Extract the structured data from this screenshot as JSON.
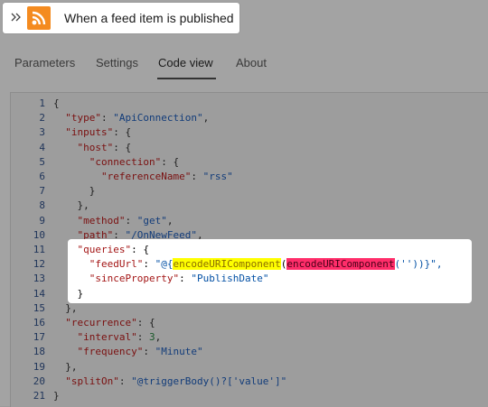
{
  "trigger": {
    "title": "When a feed item is published",
    "icon": "rss-icon",
    "accent": "#f48b20"
  },
  "tabs": [
    {
      "label": "Parameters",
      "active": false
    },
    {
      "label": "Settings",
      "active": false
    },
    {
      "label": "Code view",
      "active": true
    },
    {
      "label": "About",
      "active": false
    }
  ],
  "code": {
    "line_numbers": [
      "1",
      "2",
      "3",
      "4",
      "5",
      "6",
      "7",
      "8",
      "9",
      "10",
      "11",
      "12",
      "13",
      "14",
      "15",
      "16",
      "17",
      "18",
      "19",
      "20",
      "21"
    ],
    "lines": [
      "{",
      "  \"type\": \"ApiConnection\",",
      "  \"inputs\": {",
      "    \"host\": {",
      "      \"connection\": {",
      "        \"referenceName\": \"rss\"",
      "      }",
      "    },",
      "    \"method\": \"get\",",
      "    \"path\": \"/OnNewFeed\",",
      "    \"queries\": {",
      "      \"feedUrl\": \"@{encodeURIComponent(encodeURIComponent(''))}\",",
      "      \"sinceProperty\": \"PublishDate\"",
      "    }",
      "  },",
      "  \"recurrence\": {",
      "    \"interval\": 3,",
      "    \"frequency\": \"Minute\"",
      "  },",
      "  \"splitOn\": \"@triggerBody()?['value']\"",
      "}"
    ]
  },
  "highlights": {
    "outer_function": "encodeURIComponent",
    "inner_function": "encodeURIComponent",
    "outer_color": "#ffff00",
    "inner_color": "#ff2d6a"
  }
}
